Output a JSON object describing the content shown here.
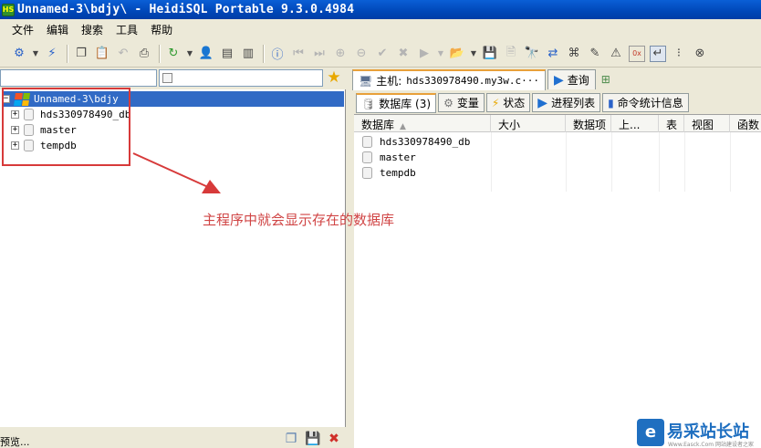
{
  "window": {
    "app_icon": "HS",
    "title": "Unnamed-3\\bdjy\\ - HeidiSQL Portable 9.3.0.4984"
  },
  "menu": [
    "文件",
    "编辑",
    "搜索",
    "工具",
    "帮助"
  ],
  "colors": {
    "selection": "#316ac5",
    "annotation": "#d73a3a",
    "accent": "#1f6fc0"
  },
  "tree": {
    "root": {
      "label": "Unnamed-3\\bdjy",
      "icon": "session-icon"
    },
    "databases": [
      "hds330978490_db",
      "master",
      "tempdb"
    ]
  },
  "tabs": {
    "host": {
      "prefix": "主机:",
      "value": "hds330978490.my3w.c···"
    },
    "query": "查询"
  },
  "subtabs": {
    "databases": "数据库 (3)",
    "variables": "变量",
    "status": "状态",
    "processes": "进程列表",
    "command_stats": "命令统计信息"
  },
  "grid": {
    "columns": [
      "数据库",
      "大小",
      "数据项",
      "上...",
      "表",
      "视图",
      "函数"
    ],
    "rows": [
      "hds330978490_db",
      "master",
      "tempdb"
    ]
  },
  "annotation": "主程序中就会显示存在的数据库",
  "status": {
    "preview": "预览..."
  },
  "watermark": {
    "logo": "e",
    "text": "易采站长站",
    "sub": "Www.Easck.Com 网站建设者之家"
  }
}
